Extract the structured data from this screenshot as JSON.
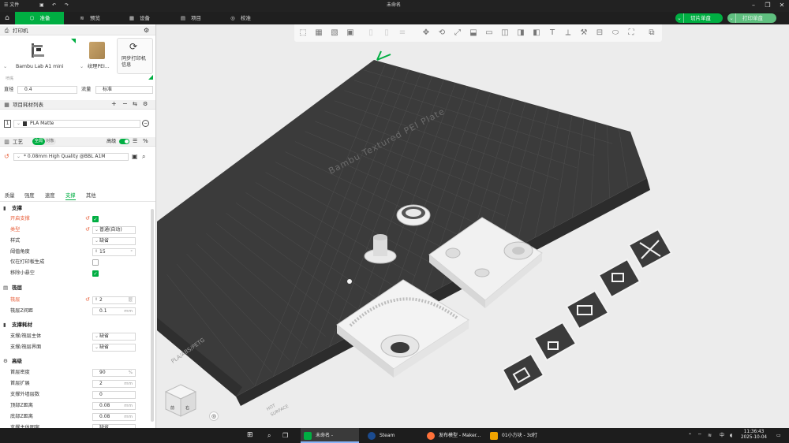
{
  "titlebar": {
    "file_menu": "文件",
    "doc_title": "未命名"
  },
  "tabs": [
    {
      "label": "准备",
      "icon": "cube-icon"
    },
    {
      "label": "预览",
      "icon": "layers-icon"
    },
    {
      "label": "设备",
      "icon": "device-icon"
    },
    {
      "label": "项目",
      "icon": "project-icon"
    },
    {
      "label": "校准",
      "icon": "calibration-icon"
    }
  ],
  "actions": {
    "slice_label": "切片单盘",
    "print_label": "打印单盘"
  },
  "printer": {
    "section_title": "打印机",
    "printer_name": "Bambu Lab A1 mini",
    "plate_name": "纹理PEI...",
    "sync_label_1": "同步打印机",
    "sync_label_2": "信息",
    "hint": "喷嘴",
    "nozzle_label": "直径",
    "nozzle_value": "0.4",
    "flow_label": "流量",
    "flow_value": "标准"
  },
  "filament": {
    "section_title": "项目耗材列表",
    "slot_number": "1",
    "filament_name": "PLA Matte"
  },
  "process": {
    "section_title": "工艺",
    "global_tab": "全局",
    "object_tab": "对象",
    "advanced_label": "高级",
    "profile": "* 0.08mm High Quality @BBL A1M",
    "subtabs": [
      "质量",
      "强度",
      "速度",
      "支撑",
      "其他"
    ]
  },
  "support_group": {
    "title": "支撑",
    "enable_label": "开启支撑",
    "type_label": "类型",
    "type_value": "普通(自动)",
    "style_label": "样式",
    "style_value": "缺省",
    "threshold_label": "阈值角度",
    "threshold_value": "15",
    "threshold_unit": "°",
    "buildplate_only_label": "仅在打印板生成",
    "remove_small_label": "移除小悬空"
  },
  "raft_group": {
    "title": "筏层",
    "layers_label": "筏层",
    "layers_value": "2",
    "layers_unit": "层",
    "z_gap_label": "筏层Z间距",
    "z_gap_value": "0.1",
    "z_gap_unit": "mm"
  },
  "support_filament_group": {
    "title": "支撑耗材",
    "base_label": "支撑/筏层主体",
    "base_value": "缺省",
    "interface_label": "支撑/筏层界面",
    "interface_value": "缺省"
  },
  "advanced_group": {
    "title": "高级",
    "rows": [
      {
        "label": "首层密度",
        "value": "90",
        "unit": "%"
      },
      {
        "label": "首层扩展",
        "value": "2",
        "unit": "mm"
      },
      {
        "label": "支撑外墙层数",
        "value": "0",
        "unit": ""
      },
      {
        "label": "顶部Z距离",
        "value": "0.08",
        "unit": "mm"
      },
      {
        "label": "底部Z距离",
        "value": "0.08",
        "unit": "mm"
      },
      {
        "label": "支撑主体图案",
        "value": "缺省",
        "unit": ""
      },
      {
        "label": "主体图案线距",
        "value": "2.5",
        "unit": "mm"
      },
      {
        "label": "模式角度",
        "value": "0",
        "unit": "°"
      }
    ]
  },
  "viewport": {
    "plate_text": "Bambu Textured PEI Plate",
    "plate_edge_text": "PLA/ABS/PETG",
    "hot_surface_1": "HOT",
    "hot_surface_2": "SURFACE",
    "cube_front": "前",
    "cube_right": "右"
  },
  "taskbar": {
    "bambu_app": "未命名 - BambuSt...",
    "steam_app": "Steam",
    "firefox_app": "发布模型 - Maker...",
    "cad_app": "01小方块 - 3d打印...",
    "ime_label": "中",
    "time": "11:36:43",
    "date": "2025-10-04"
  },
  "colors": {
    "accent": "#00ae42",
    "plate": "#3a3a3a",
    "titlebar": "#222222"
  }
}
